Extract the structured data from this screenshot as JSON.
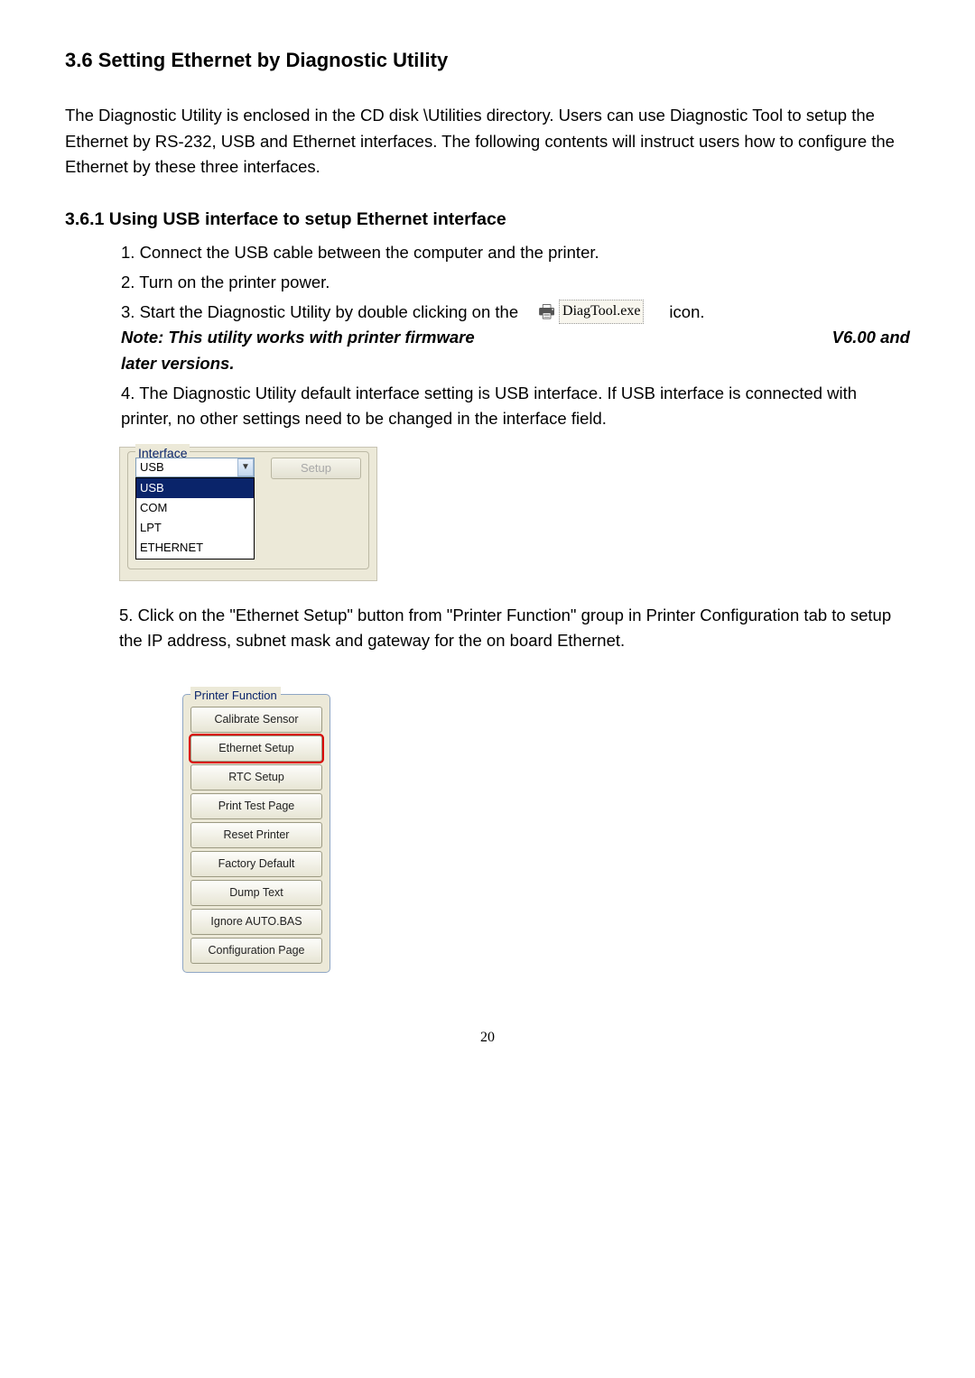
{
  "section_heading": "3.6 Setting Ethernet by Diagnostic Utility",
  "intro_para": "The Diagnostic Utility is enclosed in the CD disk \\Utilities directory. Users can use Diagnostic Tool to setup the Ethernet by RS-232, USB and Ethernet interfaces. The following contents will instruct users how to configure the Ethernet by these three interfaces.",
  "subsection_heading": "3.6.1 Using USB interface to setup Ethernet interface",
  "steps": {
    "s1": "1. Connect the USB cable between the computer and the printer.",
    "s2": "2. Turn on the printer power.",
    "s3_pre": "3. Start the Diagnostic Utility by double clicking on the",
    "s3_icon_label": "DiagTool.exe",
    "s3_post": "icon.",
    "s3_note_left": "Note: This utility works with printer firmware",
    "s3_note_right": "V6.00 and",
    "s3_note_cont": "later versions.",
    "s4": "4. The Diagnostic Utility default interface setting is USB interface. If USB interface is connected with printer, no other settings need to be changed in the interface field.",
    "s5": "5. Click on the \"Ethernet Setup\" button from \"Printer Function\" group in Printer Configuration tab to setup the IP address, subnet mask and gateway for the on board Ethernet."
  },
  "interface_panel": {
    "legend": "Interface",
    "selected": "USB",
    "options": [
      "USB",
      "COM",
      "LPT",
      "ETHERNET"
    ],
    "setup_button": "Setup"
  },
  "printer_function": {
    "legend": "Printer Function",
    "buttons": [
      "Calibrate Sensor",
      "Ethernet Setup",
      "RTC Setup",
      "Print Test Page",
      "Reset Printer",
      "Factory Default",
      "Dump Text",
      "Ignore AUTO.BAS",
      "Configuration Page"
    ],
    "highlight_index": 1
  },
  "page_number": "20"
}
